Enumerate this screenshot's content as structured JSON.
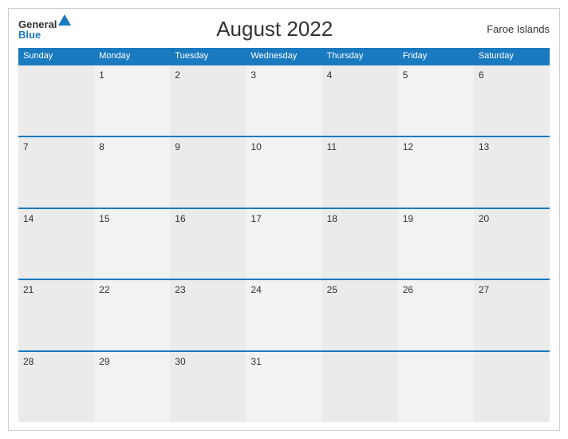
{
  "header": {
    "logo": {
      "line1": "General",
      "line2": "Blue"
    },
    "title": "August 2022",
    "region": "Faroe Islands"
  },
  "days": {
    "headers": [
      "Sunday",
      "Monday",
      "Tuesday",
      "Wednesday",
      "Thursday",
      "Friday",
      "Saturday"
    ]
  },
  "weeks": [
    [
      "",
      "1",
      "2",
      "3",
      "4",
      "5",
      "6"
    ],
    [
      "7",
      "8",
      "9",
      "10",
      "11",
      "12",
      "13"
    ],
    [
      "14",
      "15",
      "16",
      "17",
      "18",
      "19",
      "20"
    ],
    [
      "21",
      "22",
      "23",
      "24",
      "25",
      "26",
      "27"
    ],
    [
      "28",
      "29",
      "30",
      "31",
      "",
      "",
      ""
    ]
  ]
}
